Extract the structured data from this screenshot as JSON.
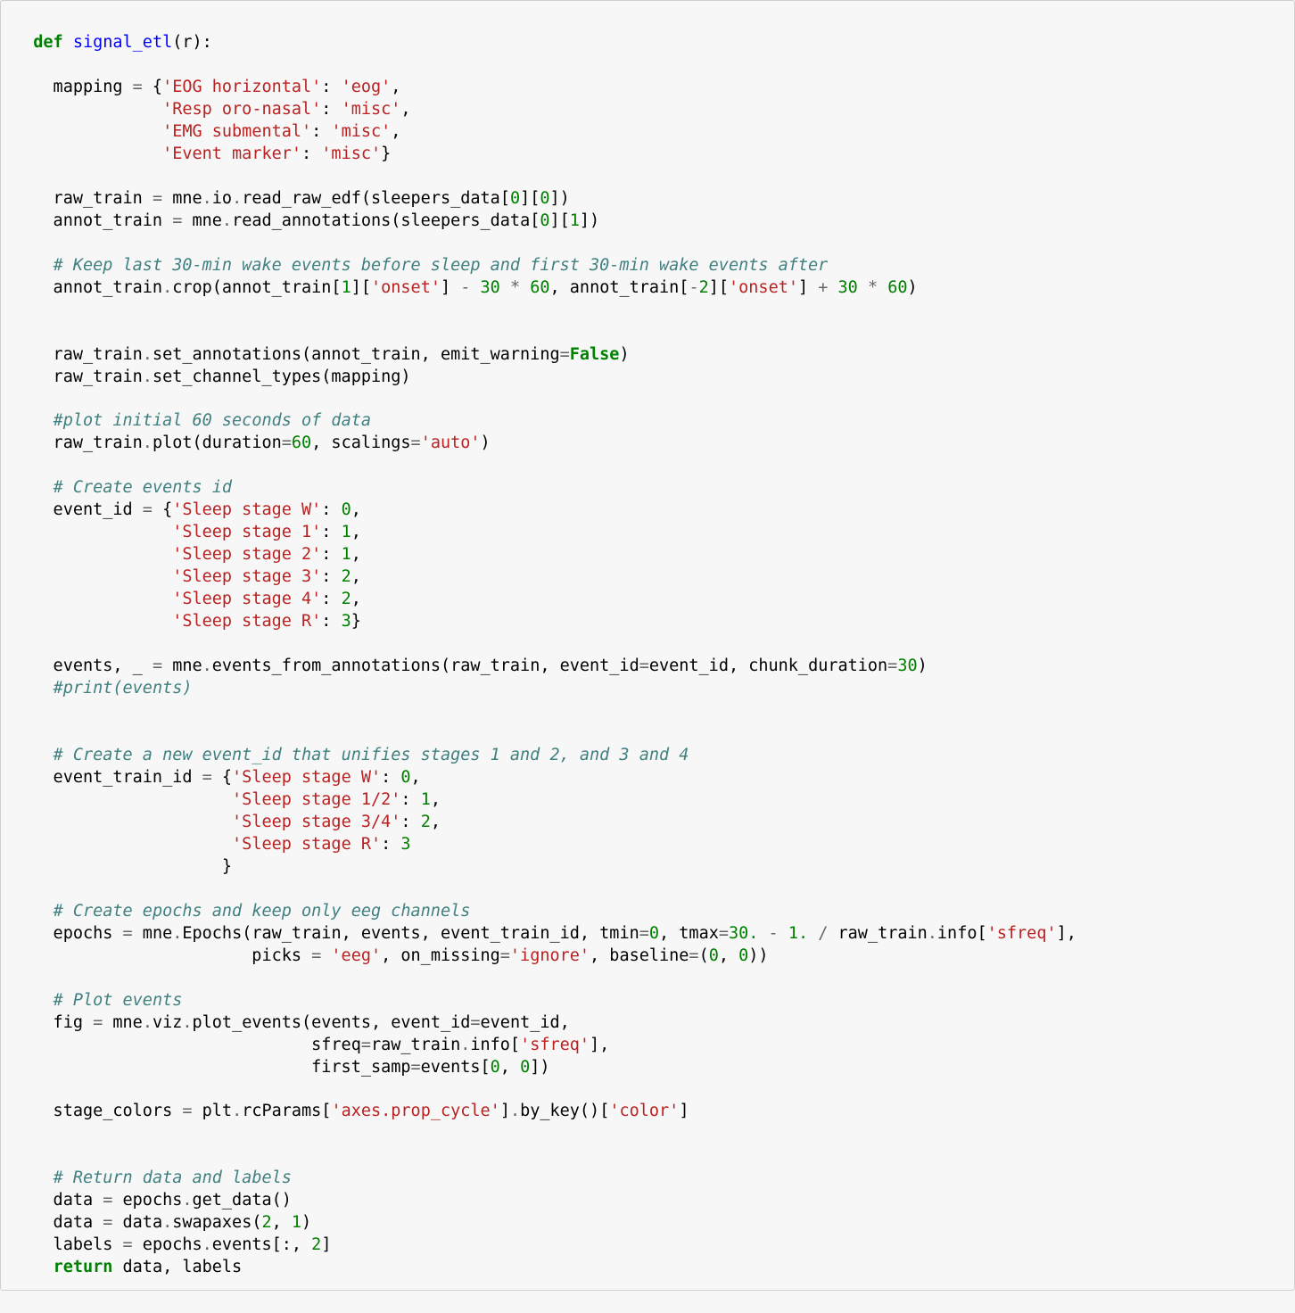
{
  "code": {
    "tokens": [
      {
        "c": "kw",
        "t": "def"
      },
      {
        "t": " "
      },
      {
        "c": "fn",
        "t": "signal_etl"
      },
      {
        "t": "(r):"
      },
      {
        "br": 2
      },
      {
        "t": "    mapping "
      },
      {
        "c": "op",
        "t": "="
      },
      {
        "t": " {"
      },
      {
        "c": "str",
        "t": "'EOG horizontal'"
      },
      {
        "t": ": "
      },
      {
        "c": "str",
        "t": "'eog'"
      },
      {
        "t": ","
      },
      {
        "br": 1
      },
      {
        "t": "               "
      },
      {
        "c": "str",
        "t": "'Resp oro-nasal'"
      },
      {
        "t": ": "
      },
      {
        "c": "str",
        "t": "'misc'"
      },
      {
        "t": ","
      },
      {
        "br": 1
      },
      {
        "t": "               "
      },
      {
        "c": "str",
        "t": "'EMG submental'"
      },
      {
        "t": ": "
      },
      {
        "c": "str",
        "t": "'misc'"
      },
      {
        "t": ","
      },
      {
        "br": 1
      },
      {
        "t": "               "
      },
      {
        "c": "str",
        "t": "'Event marker'"
      },
      {
        "t": ": "
      },
      {
        "c": "str",
        "t": "'misc'"
      },
      {
        "t": "}"
      },
      {
        "br": 2
      },
      {
        "t": "    raw_train "
      },
      {
        "c": "op",
        "t": "="
      },
      {
        "t": " mne"
      },
      {
        "c": "op",
        "t": "."
      },
      {
        "t": "io"
      },
      {
        "c": "op",
        "t": "."
      },
      {
        "t": "read_raw_edf(sleepers_data["
      },
      {
        "c": "num",
        "t": "0"
      },
      {
        "t": "]["
      },
      {
        "c": "num",
        "t": "0"
      },
      {
        "t": "])"
      },
      {
        "br": 1
      },
      {
        "t": "    annot_train "
      },
      {
        "c": "op",
        "t": "="
      },
      {
        "t": " mne"
      },
      {
        "c": "op",
        "t": "."
      },
      {
        "t": "read_annotations(sleepers_data["
      },
      {
        "c": "num",
        "t": "0"
      },
      {
        "t": "]["
      },
      {
        "c": "num",
        "t": "1"
      },
      {
        "t": "])"
      },
      {
        "br": 2
      },
      {
        "t": "    "
      },
      {
        "c": "cmt",
        "t": "# Keep last 30-min wake events before sleep and first 30-min wake events after"
      },
      {
        "br": 1
      },
      {
        "t": "    annot_train"
      },
      {
        "c": "op",
        "t": "."
      },
      {
        "t": "crop(annot_train["
      },
      {
        "c": "num",
        "t": "1"
      },
      {
        "t": "]["
      },
      {
        "c": "str",
        "t": "'onset'"
      },
      {
        "t": "] "
      },
      {
        "c": "op",
        "t": "-"
      },
      {
        "t": " "
      },
      {
        "c": "num",
        "t": "30"
      },
      {
        "t": " "
      },
      {
        "c": "op",
        "t": "*"
      },
      {
        "t": " "
      },
      {
        "c": "num",
        "t": "60"
      },
      {
        "t": ", annot_train["
      },
      {
        "c": "op",
        "t": "-"
      },
      {
        "c": "num",
        "t": "2"
      },
      {
        "t": "]["
      },
      {
        "c": "str",
        "t": "'onset'"
      },
      {
        "t": "] "
      },
      {
        "c": "op",
        "t": "+"
      },
      {
        "t": " "
      },
      {
        "c": "num",
        "t": "30"
      },
      {
        "t": " "
      },
      {
        "c": "op",
        "t": "*"
      },
      {
        "t": " "
      },
      {
        "c": "num",
        "t": "60"
      },
      {
        "t": ")"
      },
      {
        "br": 3
      },
      {
        "t": "    raw_train"
      },
      {
        "c": "op",
        "t": "."
      },
      {
        "t": "set_annotations(annot_train, emit_warning"
      },
      {
        "c": "op",
        "t": "="
      },
      {
        "c": "bi",
        "t": "False"
      },
      {
        "t": ")"
      },
      {
        "br": 1
      },
      {
        "t": "    raw_train"
      },
      {
        "c": "op",
        "t": "."
      },
      {
        "t": "set_channel_types(mapping)"
      },
      {
        "br": 2
      },
      {
        "t": "    "
      },
      {
        "c": "cmt",
        "t": "#plot initial 60 seconds of data"
      },
      {
        "br": 1
      },
      {
        "t": "    raw_train"
      },
      {
        "c": "op",
        "t": "."
      },
      {
        "t": "plot(duration"
      },
      {
        "c": "op",
        "t": "="
      },
      {
        "c": "num",
        "t": "60"
      },
      {
        "t": ", scalings"
      },
      {
        "c": "op",
        "t": "="
      },
      {
        "c": "str",
        "t": "'auto'"
      },
      {
        "t": ")"
      },
      {
        "br": 2
      },
      {
        "t": "    "
      },
      {
        "c": "cmt",
        "t": "# Create events id"
      },
      {
        "br": 1
      },
      {
        "t": "    event_id "
      },
      {
        "c": "op",
        "t": "="
      },
      {
        "t": " {"
      },
      {
        "c": "str",
        "t": "'Sleep stage W'"
      },
      {
        "t": ": "
      },
      {
        "c": "num",
        "t": "0"
      },
      {
        "t": ","
      },
      {
        "br": 1
      },
      {
        "t": "                "
      },
      {
        "c": "str",
        "t": "'Sleep stage 1'"
      },
      {
        "t": ": "
      },
      {
        "c": "num",
        "t": "1"
      },
      {
        "t": ","
      },
      {
        "br": 1
      },
      {
        "t": "                "
      },
      {
        "c": "str",
        "t": "'Sleep stage 2'"
      },
      {
        "t": ": "
      },
      {
        "c": "num",
        "t": "1"
      },
      {
        "t": ","
      },
      {
        "br": 1
      },
      {
        "t": "                "
      },
      {
        "c": "str",
        "t": "'Sleep stage 3'"
      },
      {
        "t": ": "
      },
      {
        "c": "num",
        "t": "2"
      },
      {
        "t": ","
      },
      {
        "br": 1
      },
      {
        "t": "                "
      },
      {
        "c": "str",
        "t": "'Sleep stage 4'"
      },
      {
        "t": ": "
      },
      {
        "c": "num",
        "t": "2"
      },
      {
        "t": ","
      },
      {
        "br": 1
      },
      {
        "t": "                "
      },
      {
        "c": "str",
        "t": "'Sleep stage R'"
      },
      {
        "t": ": "
      },
      {
        "c": "num",
        "t": "3"
      },
      {
        "t": "}"
      },
      {
        "br": 2
      },
      {
        "t": "    events, _ "
      },
      {
        "c": "op",
        "t": "="
      },
      {
        "t": " mne"
      },
      {
        "c": "op",
        "t": "."
      },
      {
        "t": "events_from_annotations(raw_train, event_id"
      },
      {
        "c": "op",
        "t": "="
      },
      {
        "t": "event_id, chunk_duration"
      },
      {
        "c": "op",
        "t": "="
      },
      {
        "c": "num",
        "t": "30"
      },
      {
        "t": ")"
      },
      {
        "br": 1
      },
      {
        "t": "    "
      },
      {
        "c": "cmt",
        "t": "#print(events)"
      },
      {
        "br": 3
      },
      {
        "t": "    "
      },
      {
        "c": "cmt",
        "t": "# Create a new event_id that unifies stages 1 and 2, and 3 and 4"
      },
      {
        "br": 1
      },
      {
        "t": "    event_train_id "
      },
      {
        "c": "op",
        "t": "="
      },
      {
        "t": " {"
      },
      {
        "c": "str",
        "t": "'Sleep stage W'"
      },
      {
        "t": ": "
      },
      {
        "c": "num",
        "t": "0"
      },
      {
        "t": ","
      },
      {
        "br": 1
      },
      {
        "t": "                      "
      },
      {
        "c": "str",
        "t": "'Sleep stage 1/2'"
      },
      {
        "t": ": "
      },
      {
        "c": "num",
        "t": "1"
      },
      {
        "t": ","
      },
      {
        "br": 1
      },
      {
        "t": "                      "
      },
      {
        "c": "str",
        "t": "'Sleep stage 3/4'"
      },
      {
        "t": ": "
      },
      {
        "c": "num",
        "t": "2"
      },
      {
        "t": ","
      },
      {
        "br": 1
      },
      {
        "t": "                      "
      },
      {
        "c": "str",
        "t": "'Sleep stage R'"
      },
      {
        "t": ": "
      },
      {
        "c": "num",
        "t": "3"
      },
      {
        "br": 1
      },
      {
        "t": "                     }"
      },
      {
        "br": 2
      },
      {
        "t": "    "
      },
      {
        "c": "cmt",
        "t": "# Create epochs and keep only eeg channels"
      },
      {
        "br": 1
      },
      {
        "t": "    epochs "
      },
      {
        "c": "op",
        "t": "="
      },
      {
        "t": " mne"
      },
      {
        "c": "op",
        "t": "."
      },
      {
        "t": "Epochs(raw_train, events, event_train_id, tmin"
      },
      {
        "c": "op",
        "t": "="
      },
      {
        "c": "num",
        "t": "0"
      },
      {
        "t": ", tmax"
      },
      {
        "c": "op",
        "t": "="
      },
      {
        "c": "num",
        "t": "30."
      },
      {
        "t": " "
      },
      {
        "c": "op",
        "t": "-"
      },
      {
        "t": " "
      },
      {
        "c": "num",
        "t": "1."
      },
      {
        "t": " "
      },
      {
        "c": "op",
        "t": "/"
      },
      {
        "t": " raw_train"
      },
      {
        "c": "op",
        "t": "."
      },
      {
        "t": "info["
      },
      {
        "c": "str",
        "t": "'sfreq'"
      },
      {
        "t": "],"
      },
      {
        "br": 1
      },
      {
        "t": "                        picks "
      },
      {
        "c": "op",
        "t": "="
      },
      {
        "t": " "
      },
      {
        "c": "str",
        "t": "'eeg'"
      },
      {
        "t": ", on_missing"
      },
      {
        "c": "op",
        "t": "="
      },
      {
        "c": "str",
        "t": "'ignore'"
      },
      {
        "t": ", baseline"
      },
      {
        "c": "op",
        "t": "="
      },
      {
        "t": "("
      },
      {
        "c": "num",
        "t": "0"
      },
      {
        "t": ", "
      },
      {
        "c": "num",
        "t": "0"
      },
      {
        "t": "))"
      },
      {
        "br": 2
      },
      {
        "t": "    "
      },
      {
        "c": "cmt",
        "t": "# Plot events"
      },
      {
        "br": 1
      },
      {
        "t": "    fig "
      },
      {
        "c": "op",
        "t": "="
      },
      {
        "t": " mne"
      },
      {
        "c": "op",
        "t": "."
      },
      {
        "t": "viz"
      },
      {
        "c": "op",
        "t": "."
      },
      {
        "t": "plot_events(events, event_id"
      },
      {
        "c": "op",
        "t": "="
      },
      {
        "t": "event_id,"
      },
      {
        "br": 1
      },
      {
        "t": "                              sfreq"
      },
      {
        "c": "op",
        "t": "="
      },
      {
        "t": "raw_train"
      },
      {
        "c": "op",
        "t": "."
      },
      {
        "t": "info["
      },
      {
        "c": "str",
        "t": "'sfreq'"
      },
      {
        "t": "],"
      },
      {
        "br": 1
      },
      {
        "t": "                              first_samp"
      },
      {
        "c": "op",
        "t": "="
      },
      {
        "t": "events["
      },
      {
        "c": "num",
        "t": "0"
      },
      {
        "t": ", "
      },
      {
        "c": "num",
        "t": "0"
      },
      {
        "t": "])"
      },
      {
        "br": 2
      },
      {
        "t": "    stage_colors "
      },
      {
        "c": "op",
        "t": "="
      },
      {
        "t": " plt"
      },
      {
        "c": "op",
        "t": "."
      },
      {
        "t": "rcParams["
      },
      {
        "c": "str",
        "t": "'axes.prop_cycle'"
      },
      {
        "t": "]"
      },
      {
        "c": "op",
        "t": "."
      },
      {
        "t": "by_key()["
      },
      {
        "c": "str",
        "t": "'color'"
      },
      {
        "t": "]"
      },
      {
        "br": 3
      },
      {
        "t": "    "
      },
      {
        "c": "cmt",
        "t": "# Return data and labels"
      },
      {
        "br": 1
      },
      {
        "t": "    data "
      },
      {
        "c": "op",
        "t": "="
      },
      {
        "t": " epochs"
      },
      {
        "c": "op",
        "t": "."
      },
      {
        "t": "get_data()"
      },
      {
        "br": 1
      },
      {
        "t": "    data "
      },
      {
        "c": "op",
        "t": "="
      },
      {
        "t": " data"
      },
      {
        "c": "op",
        "t": "."
      },
      {
        "t": "swapaxes("
      },
      {
        "c": "num",
        "t": "2"
      },
      {
        "t": ", "
      },
      {
        "c": "num",
        "t": "1"
      },
      {
        "t": ")"
      },
      {
        "br": 1
      },
      {
        "t": "    labels "
      },
      {
        "c": "op",
        "t": "="
      },
      {
        "t": " epochs"
      },
      {
        "c": "op",
        "t": "."
      },
      {
        "t": "events[:, "
      },
      {
        "c": "num",
        "t": "2"
      },
      {
        "t": "]"
      },
      {
        "br": 1
      },
      {
        "t": "    "
      },
      {
        "c": "kw",
        "t": "return"
      },
      {
        "t": " data, labels"
      }
    ]
  }
}
